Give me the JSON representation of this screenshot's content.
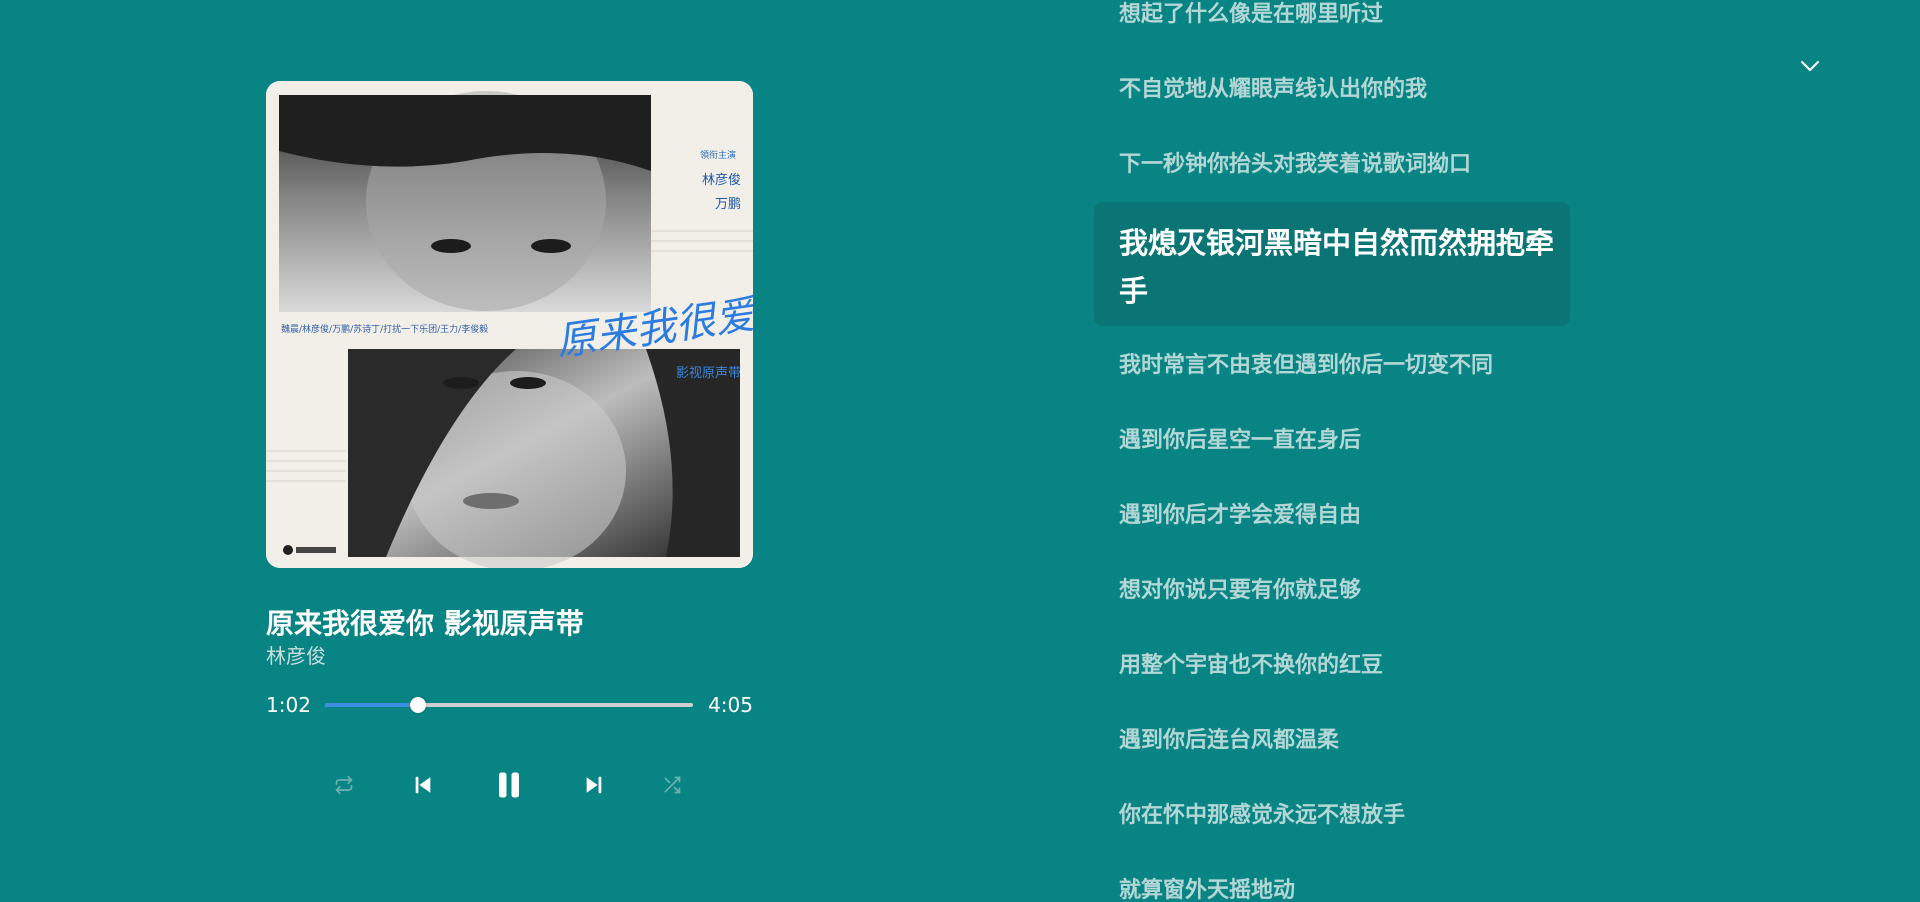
{
  "album": {
    "title": "原来我很爱你 影视原声带",
    "artist": "林彦俊",
    "cover": {
      "side_text_1": "領衔主演",
      "side_text_2": "林彦俊",
      "side_text_3": "万鹏",
      "cast_line": "魏晨/林彦俊/万鹏/苏诗丁/打扰一下乐团/王力/李俊毅",
      "script_title": "原来我很爱你",
      "subtitle": "影视原声带"
    }
  },
  "playback": {
    "current_time": "1:02",
    "duration": "4:05",
    "progress": 0.253
  },
  "controls": {
    "repeat_icon": "repeat-icon",
    "prev_icon": "skip-previous-icon",
    "pause_icon": "pause-icon",
    "next_icon": "skip-next-icon",
    "shuffle_icon": "shuffle-icon"
  },
  "header": {
    "collapse_icon": "chevron-down-icon"
  },
  "lyrics": {
    "before": [
      "想起了什么像是在哪里听过",
      "不自觉地从耀眼声线认出你的我",
      "下一秒钟你抬头对我笑着说歌词拗口"
    ],
    "active_line_1": "我熄灭银河黑暗中自然而然拥抱牵",
    "active_line_2": "手",
    "after": [
      "我时常言不由衷但遇到你后一切变不同",
      "遇到你后星空一直在身后",
      "遇到你后才学会爱得自由",
      "想对你说只要有你就足够",
      "用整个宇宙也不换你的红豆",
      "遇到你后连台风都温柔",
      "你在怀中那感觉永远不想放手",
      "就算窗外天摇地动"
    ]
  },
  "colors": {
    "background": "#078483",
    "active_lyric_bg": "#0a7574",
    "inactive_lyric": "#b3d7d6",
    "progress_fill": "#3d8fe0",
    "progress_track": "#cfcfcf"
  }
}
